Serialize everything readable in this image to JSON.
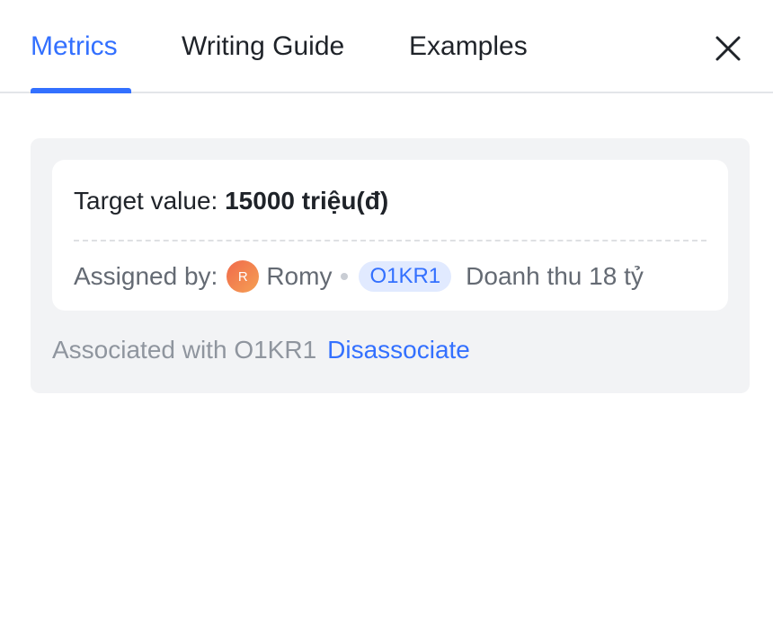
{
  "tabs": [
    {
      "label": "Metrics",
      "active": true
    },
    {
      "label": "Writing Guide",
      "active": false
    },
    {
      "label": "Examples",
      "active": false
    }
  ],
  "close_icon": "close-icon",
  "card": {
    "target_label": "Target value: ",
    "target_value": "15000 triệu(đ)",
    "assigned_label": "Assigned by:",
    "avatar_initial": "R",
    "assignee": "Romy",
    "okr_tag": "O1KR1",
    "okr_description": "Doanh thu 18 tỷ"
  },
  "association": {
    "text": "Associated with O1KR1",
    "action": "Disassociate"
  },
  "colors": {
    "accent": "#3370ff",
    "panel_bg": "#f2f3f5",
    "tag_bg": "#e1eaff"
  }
}
